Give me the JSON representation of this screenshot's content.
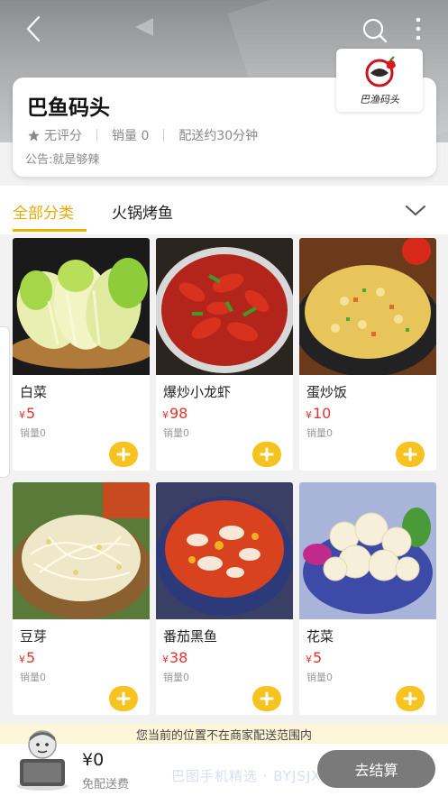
{
  "store": {
    "name": "巴鱼码头",
    "rating": "无评分",
    "sales": "销量 0",
    "delivery_time": "配送约30分钟",
    "notice": "公告:就是够辣",
    "logo_text": "巴渔码头"
  },
  "tabs": [
    {
      "label": "全部分类",
      "active": true
    },
    {
      "label": "火锅烤鱼",
      "active": false
    }
  ],
  "currency": "¥",
  "products": [
    {
      "name": "白菜",
      "price": "5",
      "sales": "销量0"
    },
    {
      "name": "爆炒小龙虾",
      "price": "98",
      "sales": "销量0"
    },
    {
      "name": "蛋炒饭",
      "price": "10",
      "sales": "销量0"
    },
    {
      "name": "豆芽",
      "price": "5",
      "sales": "销量0"
    },
    {
      "name": "番茄黑鱼",
      "price": "38",
      "sales": "销量0"
    },
    {
      "name": "花菜",
      "price": "5",
      "sales": "销量0"
    }
  ],
  "area_notice": "您当前的位置不在商家配送范围内",
  "cart": {
    "total": "¥0",
    "delivery": "免配送费",
    "checkout_label": "去结算"
  },
  "watermark": "巴图手机精选 · BYJSJXY.COM",
  "colors": {
    "accent": "#f0b400",
    "price": "#e5322d",
    "checkout": "#7a7a7a"
  }
}
